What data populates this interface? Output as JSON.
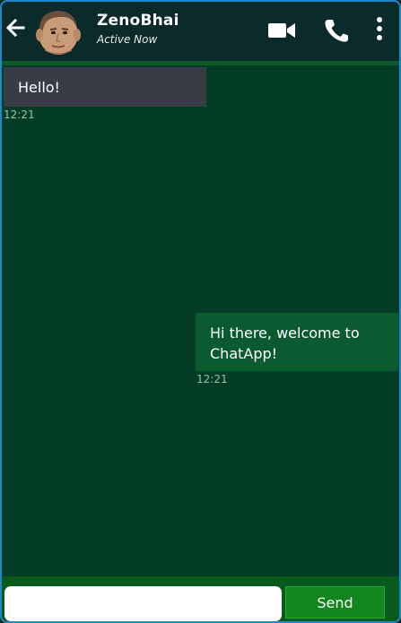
{
  "header": {
    "back_icon": "arrow-left-icon",
    "contact_name": "ZenoBhai",
    "status": "Active Now",
    "video_icon": "video-camera-icon",
    "call_icon": "phone-icon",
    "more_icon": "more-vertical-icon"
  },
  "messages": [
    {
      "direction": "incoming",
      "text": "Hello!",
      "time": "12:21"
    },
    {
      "direction": "outgoing",
      "text": "Hi there, welcome to ChatApp!",
      "time": "12:21"
    }
  ],
  "composer": {
    "input_value": "",
    "input_placeholder": "",
    "send_label": "Send"
  },
  "colors": {
    "header_bg": "#0b2a2a",
    "chat_bg": "#033d25",
    "incoming_bubble": "#383c46",
    "outgoing_bubble": "#0a5c30",
    "send_button": "#12851c",
    "frame_border": "#1f86c7"
  }
}
